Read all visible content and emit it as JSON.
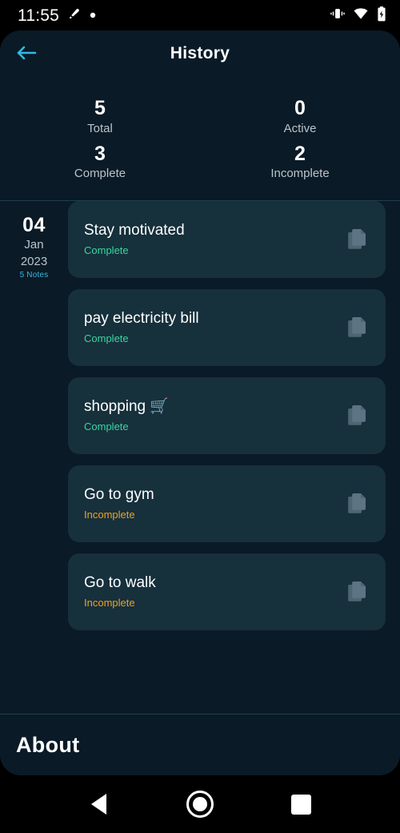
{
  "status_bar": {
    "time": "11:55",
    "left_icons": [
      "vpn-key-icon",
      "dot-indicator-icon"
    ],
    "right_icons": [
      "vibrate-icon",
      "wifi-icon",
      "battery-charging-icon"
    ]
  },
  "header": {
    "title": "History",
    "back_label": "Back",
    "accent_color": "#35b8e0"
  },
  "stats": [
    {
      "value": "5",
      "label": "Total"
    },
    {
      "value": "0",
      "label": "Active"
    },
    {
      "value": "3",
      "label": "Complete"
    },
    {
      "value": "2",
      "label": "Incomplete"
    }
  ],
  "date_group": {
    "day": "04",
    "month": "Jan",
    "year": "2023",
    "note_count": "5 Notes"
  },
  "notes": [
    {
      "title": "Stay motivated",
      "status": "Complete",
      "state": "complete",
      "icon": "copy-document-icon"
    },
    {
      "title": "pay electricity bill",
      "status": "Complete",
      "state": "complete",
      "icon": "copy-document-icon"
    },
    {
      "title": "shopping 🛒",
      "status": "Complete",
      "state": "complete",
      "icon": "copy-document-icon"
    },
    {
      "title": "Go to gym",
      "status": "Incomplete",
      "state": "incomplete",
      "icon": "copy-document-icon"
    },
    {
      "title": "Go to walk",
      "status": "Incomplete",
      "state": "incomplete",
      "icon": "copy-document-icon"
    }
  ],
  "about": {
    "title": "About"
  },
  "nav_bar": {
    "back": "back-nav-button",
    "home": "home-nav-button",
    "recents": "recents-nav-button"
  },
  "colors": {
    "background": "#0a1a26",
    "card": "#16303c",
    "accent": "#35b8e0",
    "complete": "#3ad6a0",
    "incomplete": "#f0a020"
  }
}
